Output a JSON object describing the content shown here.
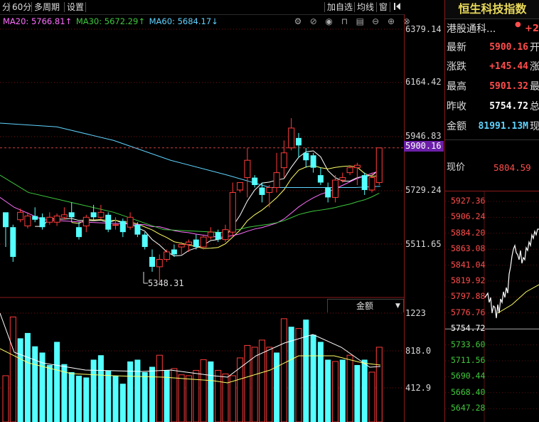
{
  "toolbar": {
    "left_items": [
      "分",
      "60分",
      "多周期",
      "设置"
    ],
    "right_items": [
      "加自选",
      "均线",
      "窗"
    ]
  },
  "ma_legend": [
    {
      "label": "MA20: 5766.81↑",
      "color": "#ff6eff"
    },
    {
      "label": "MA30: 5672.29↑",
      "color": "#3ec83e"
    },
    {
      "label": "MA60: 5684.17↓",
      "color": "#5fd3ff"
    }
  ],
  "tool_icons": [
    "settings-icon",
    "eye-off-icon",
    "eye-icon",
    "lock-icon",
    "delete-icon",
    "minus-icon",
    "plus-icon",
    "close-icon"
  ],
  "price_axis": [
    "6379.14",
    "6164.42",
    "5946.83",
    "5729.24",
    "5511.65"
  ],
  "current_price_tag": "5900.16",
  "low_marker": "5348.31",
  "volume": {
    "selector_label": "金额",
    "axis": [
      "1223",
      "818.0",
      "412.9"
    ]
  },
  "panel": {
    "title": "恒生科技指数",
    "subtitle": "港股通科...",
    "subtitle_value": "+2.",
    "rows": [
      {
        "key": "最新",
        "value": "5900.16",
        "suffix": "开"
      },
      {
        "key": "涨跌",
        "value": "+145.44",
        "suffix": "涨"
      },
      {
        "key": "最高",
        "value": "5901.32",
        "suffix": "最"
      },
      {
        "key": "昨收",
        "value": "5754.72",
        "suffix": "总"
      },
      {
        "key": "金额",
        "value": "81991.13M",
        "suffix": "现"
      }
    ],
    "cursor_label": "现价",
    "cursor_value": "5804.59",
    "mini_axis": [
      {
        "v": "5927.36",
        "c": "#ff4d4d"
      },
      {
        "v": "5906.24",
        "c": "#ff4d4d"
      },
      {
        "v": "5884.20",
        "c": "#ff4d4d"
      },
      {
        "v": "5863.08",
        "c": "#ff4d4d"
      },
      {
        "v": "5841.04",
        "c": "#ff4d4d"
      },
      {
        "v": "5819.92",
        "c": "#ff4d4d"
      },
      {
        "v": "5797.88",
        "c": "#ff4d4d"
      },
      {
        "v": "5776.76",
        "c": "#ff4d4d"
      },
      {
        "v": "5754.72",
        "c": "#ffffff"
      },
      {
        "v": "5733.60",
        "c": "#3ec83e"
      },
      {
        "v": "5711.56",
        "c": "#3ec83e"
      },
      {
        "v": "5690.44",
        "c": "#3ec83e"
      },
      {
        "v": "5668.40",
        "c": "#3ec83e"
      },
      {
        "v": "5647.28",
        "c": "#3ec83e"
      }
    ]
  },
  "colors": {
    "up": "#ff3b3b",
    "down": "#54ffff",
    "ma5": "#ffffff",
    "ma10": "#ffff66"
  },
  "candles": [
    [
      5640,
      5580,
      5630,
      5500
    ],
    [
      5580,
      5460,
      5590,
      5440
    ],
    [
      5610,
      5640,
      5655,
      5600
    ],
    [
      5585,
      5625,
      5640,
      5575
    ],
    [
      5625,
      5610,
      5660,
      5600
    ],
    [
      5620,
      5580,
      5635,
      5570
    ],
    [
      5600,
      5620,
      5640,
      5590
    ],
    [
      5600,
      5625,
      5635,
      5585
    ],
    [
      5620,
      5630,
      5660,
      5610
    ],
    [
      5640,
      5620,
      5680,
      5600
    ],
    [
      5580,
      5540,
      5600,
      5530
    ],
    [
      5585,
      5620,
      5630,
      5560
    ],
    [
      5640,
      5620,
      5670,
      5610
    ],
    [
      5620,
      5640,
      5670,
      5610
    ],
    [
      5630,
      5570,
      5640,
      5560
    ],
    [
      5590,
      5590,
      5620,
      5570
    ],
    [
      5605,
      5560,
      5615,
      5540
    ],
    [
      5580,
      5620,
      5640,
      5570
    ],
    [
      5590,
      5550,
      5600,
      5540
    ],
    [
      5550,
      5500,
      5560,
      5490
    ],
    [
      5460,
      5420,
      5490,
      5400
    ],
    [
      5420,
      5450,
      5470,
      5360
    ],
    [
      5450,
      5480,
      5490,
      5440
    ],
    [
      5490,
      5470,
      5510,
      5460
    ],
    [
      5500,
      5510,
      5520,
      5470
    ],
    [
      5510,
      5520,
      5530,
      5480
    ],
    [
      5530,
      5500,
      5550,
      5490
    ],
    [
      5500,
      5540,
      5550,
      5490
    ],
    [
      5540,
      5560,
      5580,
      5530
    ],
    [
      5560,
      5530,
      5570,
      5520
    ],
    [
      5530,
      5570,
      5590,
      5520
    ],
    [
      5560,
      5720,
      5760,
      5540
    ],
    [
      5730,
      5760,
      5760,
      5720
    ],
    [
      5780,
      5850,
      5900,
      5700
    ],
    [
      5780,
      5750,
      5790,
      5740
    ],
    [
      5740,
      5710,
      5760,
      5680
    ],
    [
      5720,
      5740,
      5750,
      5660
    ],
    [
      5740,
      5800,
      5880,
      5720
    ],
    [
      5820,
      5880,
      5930,
      5780
    ],
    [
      5900,
      5980,
      6020,
      5890
    ],
    [
      5940,
      5910,
      5960,
      5860
    ],
    [
      5880,
      5850,
      5900,
      5820
    ],
    [
      5870,
      5820,
      5880,
      5800
    ],
    [
      5790,
      5760,
      5820,
      5750
    ],
    [
      5740,
      5700,
      5760,
      5680
    ],
    [
      5700,
      5770,
      5790,
      5680
    ],
    [
      5770,
      5780,
      5800,
      5760
    ],
    [
      5800,
      5820,
      5830,
      5790
    ],
    [
      5820,
      5830,
      5840,
      5750
    ],
    [
      5790,
      5730,
      5800,
      5710
    ],
    [
      5730,
      5780,
      5800,
      5720
    ],
    [
      5760,
      5900,
      5901,
      5750
    ]
  ],
  "vol_bars": [
    [
      520,
      1
    ],
    [
      1180,
      1
    ],
    [
      940,
      0
    ],
    [
      1000,
      0
    ],
    [
      850,
      0
    ],
    [
      780,
      0
    ],
    [
      640,
      0
    ],
    [
      900,
      0
    ],
    [
      650,
      0
    ],
    [
      560,
      0
    ],
    [
      520,
      0
    ],
    [
      500,
      0
    ],
    [
      700,
      0
    ],
    [
      750,
      0
    ],
    [
      580,
      0
    ],
    [
      520,
      0
    ],
    [
      430,
      0
    ],
    [
      680,
      0
    ],
    [
      700,
      0
    ],
    [
      560,
      0
    ],
    [
      620,
      0
    ],
    [
      750,
      1
    ],
    [
      580,
      0
    ],
    [
      600,
      1
    ],
    [
      530,
      1
    ],
    [
      520,
      1
    ],
    [
      580,
      1
    ],
    [
      700,
      1
    ],
    [
      680,
      0
    ],
    [
      580,
      1
    ],
    [
      540,
      1
    ],
    [
      520,
      1
    ],
    [
      720,
      1
    ],
    [
      860,
      1
    ],
    [
      840,
      1
    ],
    [
      920,
      1
    ],
    [
      840,
      1
    ],
    [
      780,
      0
    ],
    [
      1160,
      1
    ],
    [
      1070,
      0
    ],
    [
      1050,
      1
    ],
    [
      1150,
      0
    ],
    [
      980,
      0
    ],
    [
      900,
      0
    ],
    [
      700,
      0
    ],
    [
      680,
      1
    ],
    [
      700,
      0
    ],
    [
      750,
      1
    ],
    [
      640,
      0
    ],
    [
      700,
      0
    ],
    [
      560,
      1
    ],
    [
      840,
      1
    ]
  ],
  "ma_vol": [
    [
      [
        0,
        440
      ],
      [
        20,
        495
      ],
      [
        60,
        510
      ],
      [
        120,
        520
      ],
      [
        200,
        522
      ],
      [
        240,
        520
      ],
      [
        300,
        528
      ],
      [
        320,
        530
      ],
      [
        360,
        500
      ],
      [
        400,
        482
      ],
      [
        440,
        470
      ],
      [
        480,
        488
      ],
      [
        520,
        516
      ],
      [
        535,
        515
      ]
    ],
    [
      [
        0,
        490
      ],
      [
        40,
        510
      ],
      [
        100,
        525
      ],
      [
        160,
        528
      ],
      [
        230,
        530
      ],
      [
        300,
        535
      ],
      [
        320,
        538
      ],
      [
        380,
        520
      ],
      [
        420,
        500
      ],
      [
        470,
        500
      ],
      [
        510,
        510
      ],
      [
        535,
        513
      ]
    ]
  ],
  "mini_line": [
    [
      682,
      418
    ],
    [
      686,
      412
    ],
    [
      688,
      425
    ],
    [
      690,
      418
    ],
    [
      692,
      440
    ],
    [
      694,
      430
    ],
    [
      696,
      432
    ],
    [
      698,
      447
    ],
    [
      700,
      428
    ],
    [
      702,
      440
    ],
    [
      704,
      420
    ],
    [
      706,
      425
    ],
    [
      708,
      410
    ],
    [
      710,
      418
    ],
    [
      712,
      404
    ],
    [
      714,
      412
    ],
    [
      716,
      385
    ],
    [
      718,
      375
    ],
    [
      720,
      360
    ],
    [
      722,
      350
    ],
    [
      724,
      345
    ],
    [
      726,
      355
    ],
    [
      728,
      358
    ],
    [
      730,
      365
    ],
    [
      732,
      352
    ],
    [
      734,
      370
    ],
    [
      736,
      362
    ],
    [
      738,
      365
    ],
    [
      740,
      348
    ],
    [
      742,
      352
    ],
    [
      744,
      340
    ],
    [
      746,
      345
    ],
    [
      748,
      330
    ],
    [
      750,
      335
    ],
    [
      752,
      325
    ],
    [
      754,
      330
    ],
    [
      756,
      322
    ],
    [
      758,
      322
    ]
  ],
  "mini_avg": [
    [
      700,
      440
    ],
    [
      720,
      428
    ],
    [
      740,
      410
    ],
    [
      758,
      400
    ]
  ]
}
